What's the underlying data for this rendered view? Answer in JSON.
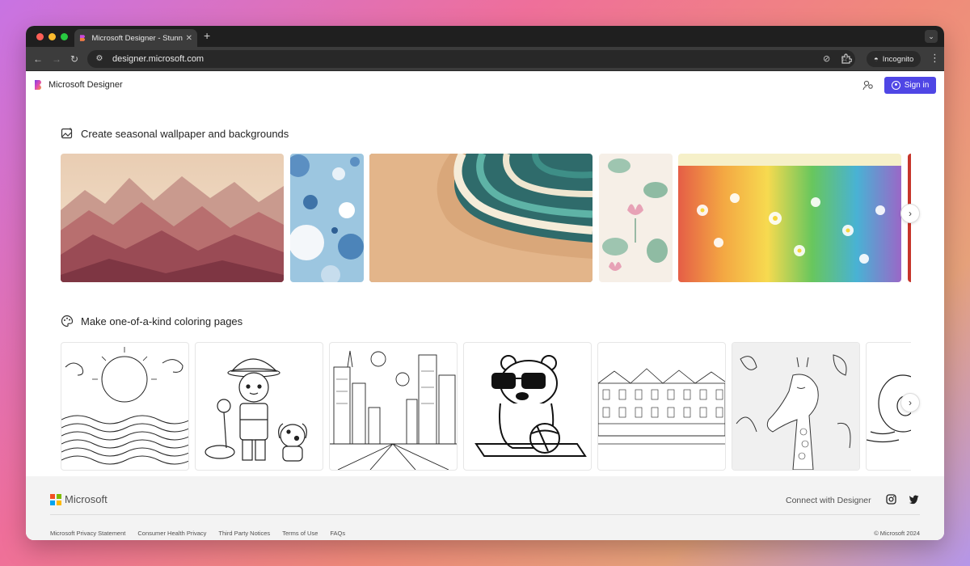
{
  "browser": {
    "tab_title": "Microsoft Designer - Stunning",
    "new_tab_symbol": "+",
    "url": "designer.microsoft.com",
    "incognito_label": "Incognito"
  },
  "header": {
    "brand_name": "Microsoft Designer",
    "signin_label": "Sign in",
    "accent_color": "#4f46e5"
  },
  "sections": [
    {
      "title": "Create seasonal wallpaper and backgrounds",
      "icon": "image-sparkle-icon",
      "images": [
        "mountain-range-wallpaper",
        "blue-bubbles-wallpaper",
        "ocean-wave-beach-wallpaper",
        "lotus-pattern-wallpaper",
        "rainbow-flower-field-wallpaper",
        "partial-red-wallpaper"
      ]
    },
    {
      "title": "Make one-of-a-kind coloring pages",
      "icon": "palette-icon",
      "images": [
        "sun-waves-coloring",
        "firefighter-dalmatian-coloring",
        "city-skyline-coloring",
        "bear-sunglasses-coloring",
        "row-houses-coloring",
        "giraffe-coloring",
        "partial-donut-coloring"
      ]
    }
  ],
  "footer": {
    "brand": "Microsoft",
    "connect_label": "Connect with Designer",
    "links": [
      "Microsoft Privacy Statement",
      "Consumer Health Privacy",
      "Third Party Notices",
      "Terms of Use",
      "FAQs"
    ],
    "copyright": "© Microsoft 2024"
  }
}
